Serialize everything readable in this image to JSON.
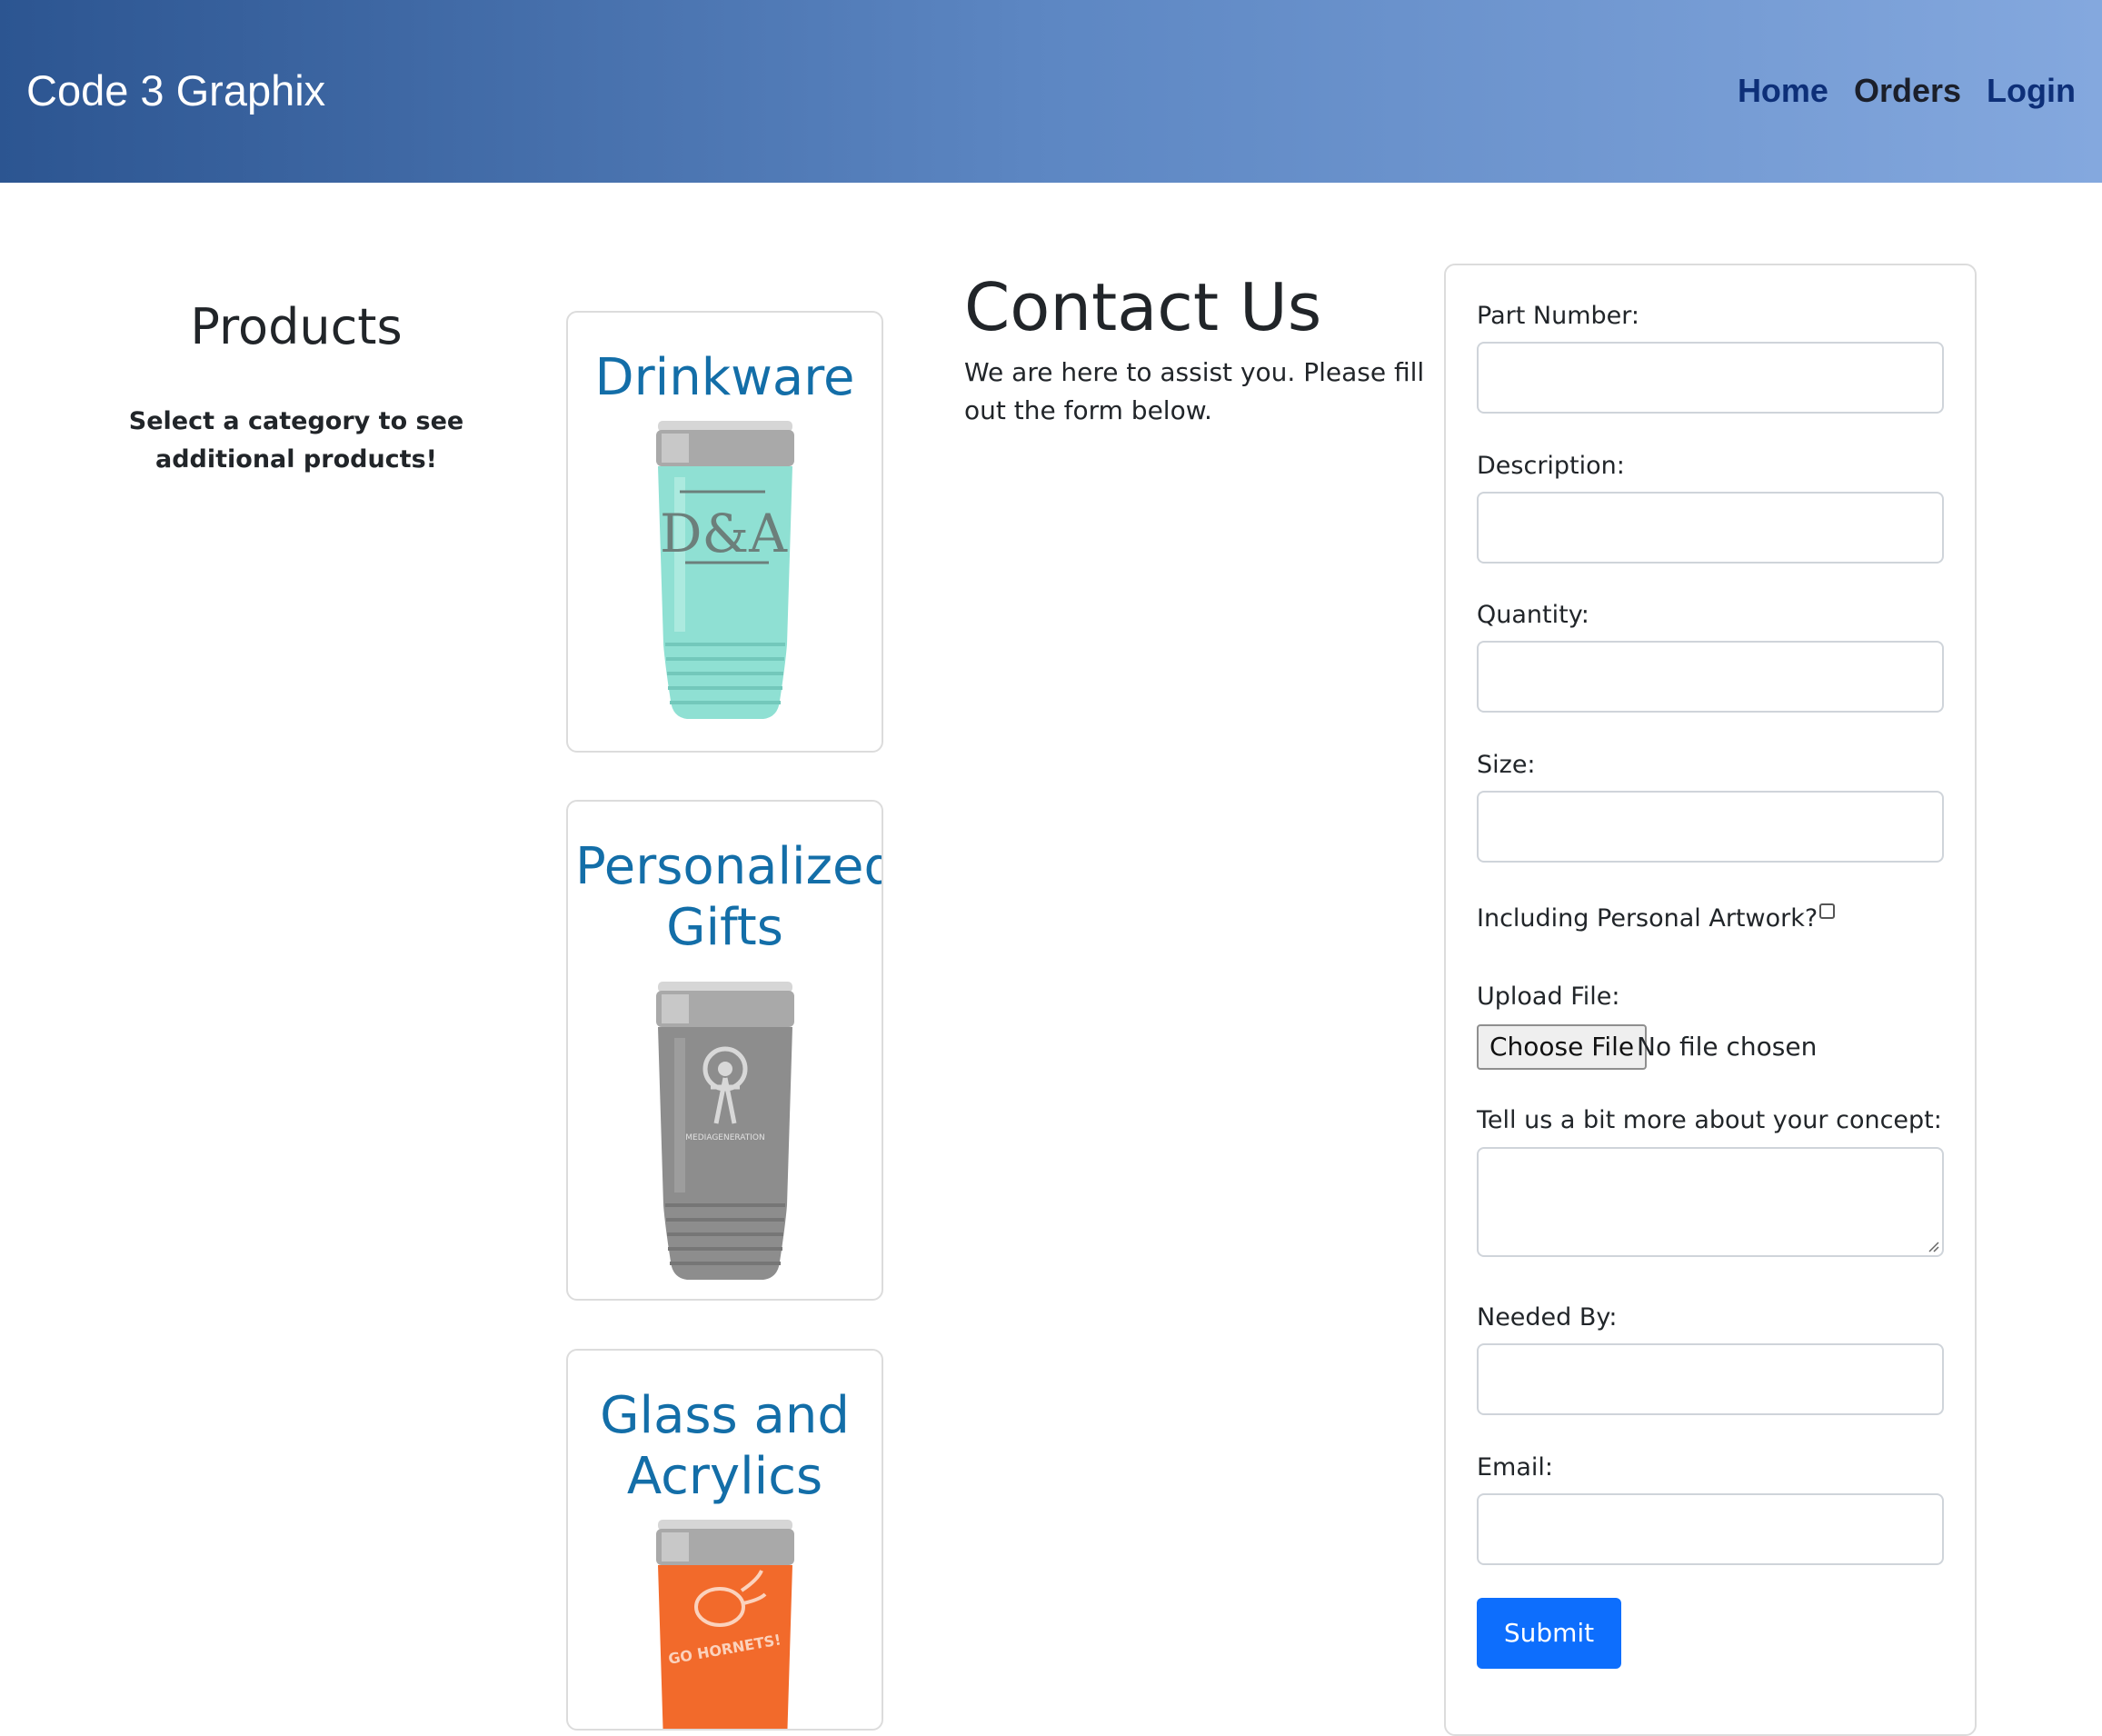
{
  "header": {
    "brand": "Code 3 Graphix",
    "nav": [
      {
        "label": "Home"
      },
      {
        "label": "Orders"
      },
      {
        "label": "Login"
      }
    ]
  },
  "products": {
    "heading": "Products",
    "subtitle": "Select a category to see additional products!",
    "categories": [
      {
        "title": "Drinkware",
        "image_color": "#8fe0d3",
        "image": "tumbler-icon"
      },
      {
        "title": "Personalized Gifts",
        "image_color": "#8d8d8d",
        "image": "tumbler-icon"
      },
      {
        "title": "Glass and Acrylics",
        "image_color": "#f26a2b",
        "image": "tumbler-icon"
      }
    ]
  },
  "contact": {
    "title": "Contact Us",
    "text": "We are here to assist you. Please fill out the form below."
  },
  "form": {
    "part_number_label": "Part Number:",
    "description_label": "Description:",
    "quantity_label": "Quantity:",
    "size_label": "Size:",
    "artwork_label": "Including Personal Artwork?",
    "artwork_checked": false,
    "upload_label": "Upload File:",
    "choose_file_label": "Choose File",
    "file_status": "No file chosen",
    "concept_label": "Tell us a bit more about your concept:",
    "needed_by_label": "Needed By:",
    "email_label": "Email:",
    "submit_label": "Submit"
  },
  "tumbler_prints": {
    "drinkware_monogram": "D&A",
    "gifts_logo_text": "MEDIAGENERATION",
    "glass_print_text": "GO HORNETS!"
  }
}
